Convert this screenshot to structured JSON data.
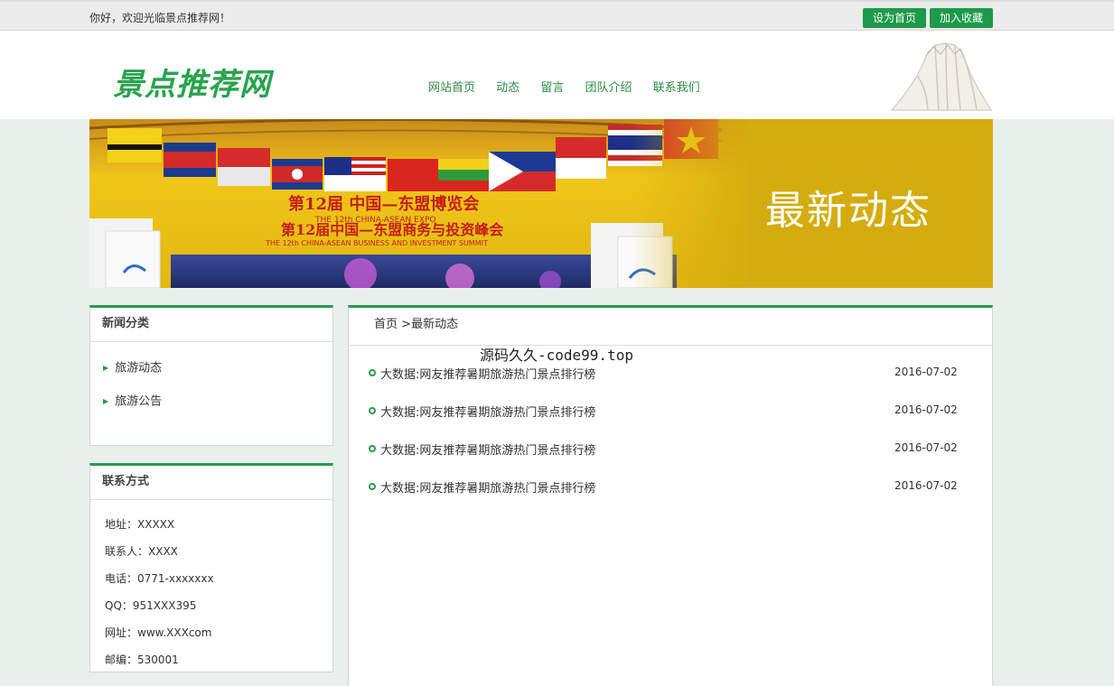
{
  "topbar": {
    "welcome": "你好，欢迎光临景点推荐网！",
    "set_home": "设为首页",
    "add_favorite": "加入收藏"
  },
  "header": {
    "logo": "景点推荐网",
    "nav": [
      "网站首页",
      "动态",
      "留言",
      "团队介绍",
      "联系我们"
    ]
  },
  "banner": {
    "title": "最新动态",
    "expo_line1": "第12届 中国—东盟博览会",
    "expo_line2": "THE 12th CHINA-ASEAN EXPO",
    "expo_line3": "第12届中国—东盟商务与投资峰会",
    "expo_line4": "THE 12th CHINA-ASEAN BUSINESS AND INVESTMENT SUMMIT"
  },
  "categories": {
    "title": "新闻分类",
    "items": [
      "旅游动态",
      "旅游公告"
    ]
  },
  "contact": {
    "title": "联系方式",
    "rows": [
      "地址：XXXXX",
      "联系人：XXXX",
      "电话：0771-xxxxxxx",
      "QQ：951XXX395",
      "网址：www.XXXcom",
      "邮编：530001"
    ]
  },
  "main": {
    "crumb_home": "首页",
    "crumb_sep": ">",
    "crumb_current": "最新动态",
    "news": [
      {
        "title": "大数据:网友推荐暑期旅游热门景点排行榜",
        "date": "2016-07-02"
      },
      {
        "title": "大数据:网友推荐暑期旅游热门景点排行榜",
        "date": "2016-07-02"
      },
      {
        "title": "大数据:网友推荐暑期旅游热门景点排行榜",
        "date": "2016-07-02"
      },
      {
        "title": "大数据:网友推荐暑期旅游热门景点排行榜",
        "date": "2016-07-02"
      }
    ]
  },
  "watermark": "源码久久-code99.top",
  "colors": {
    "accent": "#2a9a4c",
    "button": "#1e9a4b",
    "banner_gold": "#d4ac0e"
  }
}
